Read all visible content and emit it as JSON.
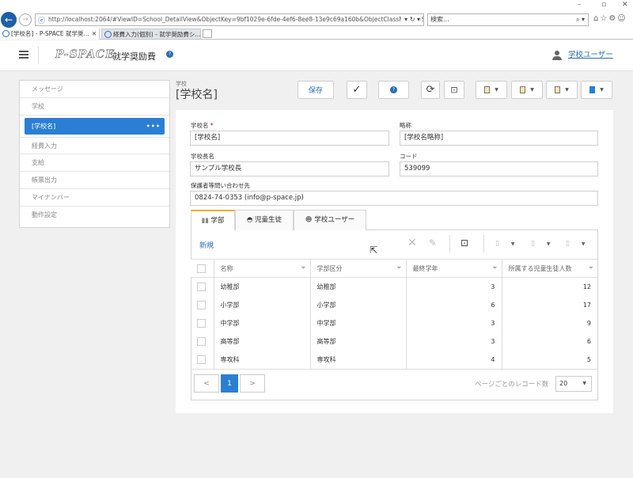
{
  "browser": {
    "url": "http://localhost:2064/#ViewID=School_DetailView&ObjectKey=9bf1029e-6fde-4ef6-8ee8-13e9c69a160b&ObjectClassName=SyusyoSyst",
    "search_placeholder": "検索...",
    "tabs": [
      {
        "label": "[学校名] - P-SPACE 就学奨..."
      },
      {
        "label": "経費入力(個別) - 就学奨励費シ..."
      }
    ]
  },
  "header": {
    "logo": "P-SPACE",
    "app_title": "就学奨励費",
    "user_label": "学校ユーザー"
  },
  "sidebar": {
    "items": [
      {
        "label": "メッセージ"
      },
      {
        "label": "学校"
      },
      {
        "label": "[学校名]",
        "active": true
      },
      {
        "label": "経費入力"
      },
      {
        "label": "支給"
      },
      {
        "label": "帳票出力"
      },
      {
        "label": "マイナンバー"
      },
      {
        "label": "動作設定"
      }
    ]
  },
  "page": {
    "subtitle": "学校",
    "title": "[学校名]"
  },
  "toolbar": {
    "save_label": "保存"
  },
  "form": {
    "school_name_label": "学校名",
    "school_name_value": "[学校名]",
    "abbr_label": "略称",
    "abbr_value": "[学校名略称]",
    "principal_label": "学校長名",
    "principal_value": "サンプル学校長",
    "code_label": "コード",
    "code_value": "539099",
    "contact_label": "保護者等問い合わせ先",
    "contact_value": "0824-74-0353 (info@p-space.jp)"
  },
  "inner_tabs": [
    {
      "label": "学部"
    },
    {
      "label": "児童生徒"
    },
    {
      "label": "学校ユーザー"
    }
  ],
  "grid": {
    "new_label": "新規",
    "columns": [
      "名称",
      "学部区分",
      "最終学年",
      "所属する児童生徒人数"
    ],
    "rows": [
      [
        "幼稚部",
        "幼稚部",
        "3",
        "12"
      ],
      [
        "小学部",
        "小学部",
        "6",
        "17"
      ],
      [
        "中学部",
        "中学部",
        "3",
        "9"
      ],
      [
        "高等部",
        "高等部",
        "3",
        "6"
      ],
      [
        "専攻科",
        "専攻科",
        "4",
        "5"
      ]
    ],
    "current_page": "1",
    "page_size_label": "ページごとのレコード数",
    "page_size": "20"
  },
  "colors": {
    "accent": "#2a7fd4",
    "tab_highlight": "#f0ad2e"
  }
}
